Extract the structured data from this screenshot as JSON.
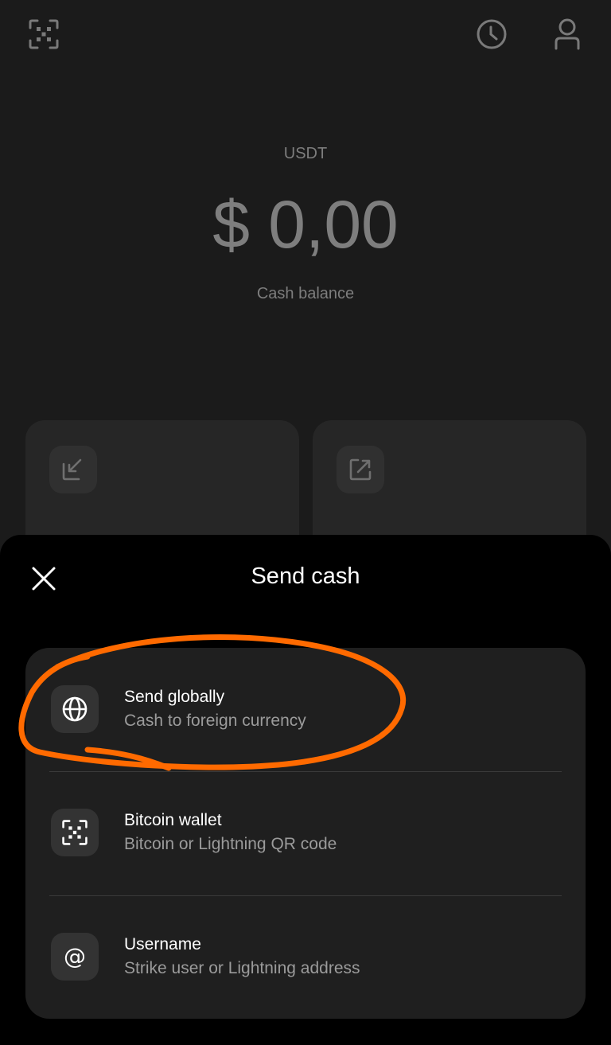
{
  "balance": {
    "currency": "USDT",
    "amount": "$ 0,00",
    "label": "Cash balance"
  },
  "top_bar": {
    "icons": [
      "scan-icon",
      "history-clock-icon",
      "profile-icon"
    ]
  },
  "action_cards": [
    {
      "icon": "receive-arrow-icon"
    },
    {
      "icon": "send-arrow-icon"
    }
  ],
  "sheet": {
    "title": "Send cash",
    "options": [
      {
        "title": "Send globally",
        "subtitle": "Cash to foreign currency",
        "icon": "globe-icon"
      },
      {
        "title": "Bitcoin wallet",
        "subtitle": "Bitcoin or Lightning QR code",
        "icon": "qr-scan-icon"
      },
      {
        "title": "Username",
        "subtitle": "Strike user or Lightning address",
        "icon": "at-icon",
        "glyph": "@"
      }
    ]
  },
  "colors": {
    "background": "#1b1b1b",
    "sheet": "#000000",
    "option_card": "#1f1f1f",
    "annotation": "#ff6a00"
  }
}
